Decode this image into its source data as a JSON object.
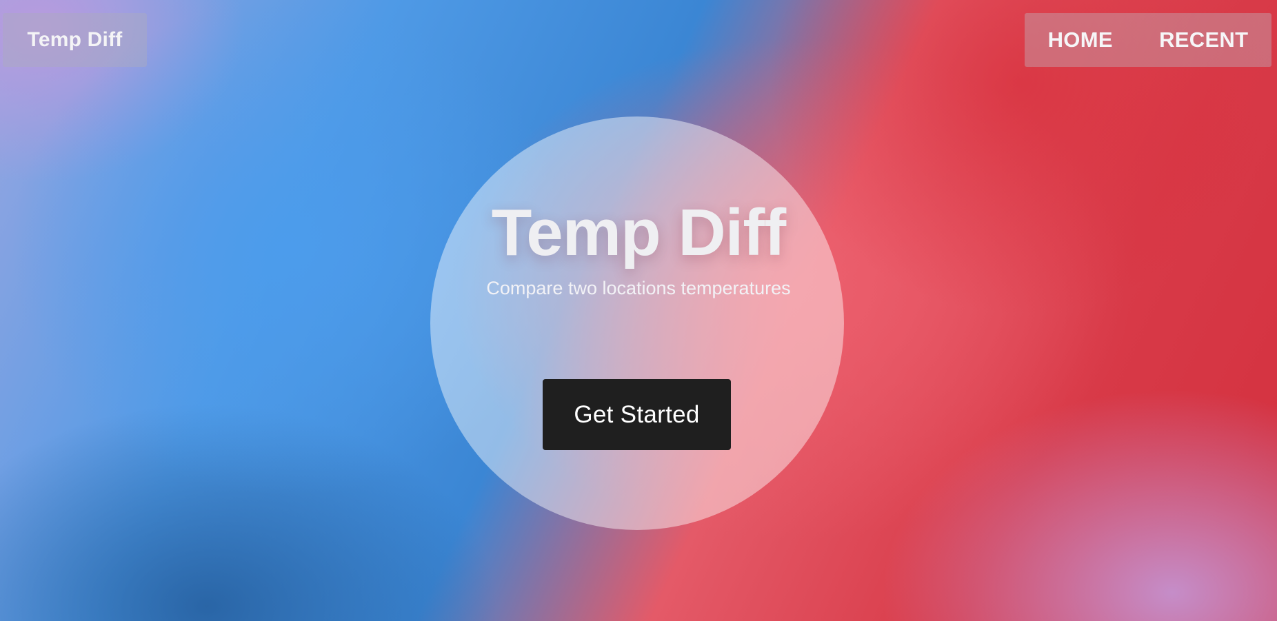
{
  "header": {
    "brand_label": "Temp Diff",
    "nav": [
      {
        "label": "HOME"
      },
      {
        "label": "RECENT"
      }
    ]
  },
  "hero": {
    "title": "Temp Diff",
    "subtitle": "Compare two locations temperatures",
    "cta_label": "Get Started"
  },
  "colors": {
    "cta_background": "#1f1f1f",
    "cta_text": "#ffffff",
    "gradient_blue": "#4f9ae6",
    "gradient_red": "#d83a48",
    "gradient_violet": "#c492d0"
  }
}
